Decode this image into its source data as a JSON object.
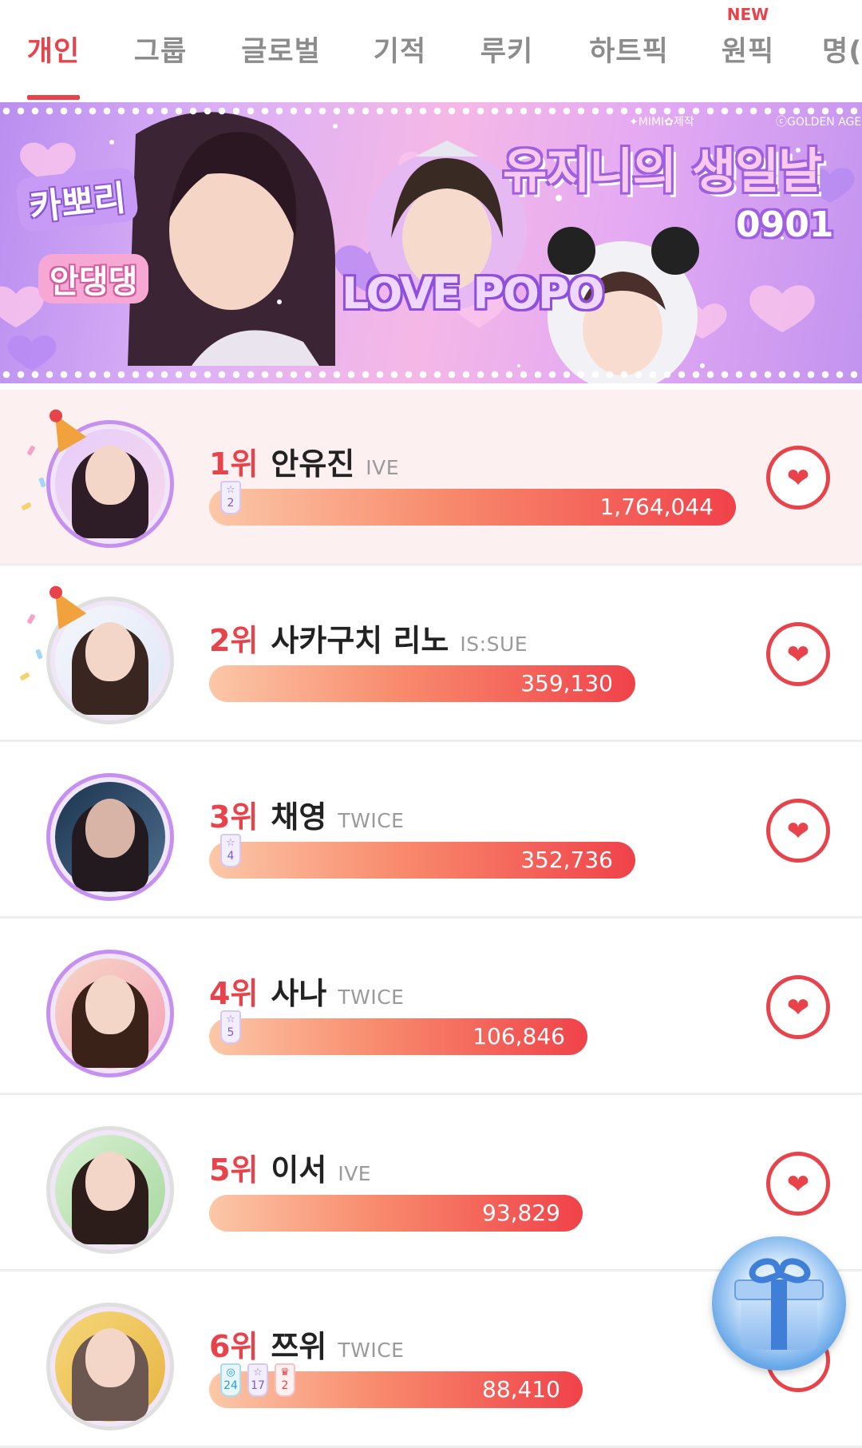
{
  "tabs": [
    {
      "label": "개인",
      "active": true
    },
    {
      "label": "그룹"
    },
    {
      "label": "글로벌"
    },
    {
      "label": "기적"
    },
    {
      "label": "루키"
    },
    {
      "label": "하트픽"
    },
    {
      "label": "원픽",
      "badge": "NEW"
    },
    {
      "label": "명("
    }
  ],
  "banner": {
    "tag1": "카뽀리",
    "tag2": "안댕댕",
    "title": "유지니의 생일날",
    "date": "0901",
    "love": "LOVE POPO",
    "credit_left": "✦MIMI✿제작",
    "credit_right": "ⓒGOLDEN AGE"
  },
  "ranking": [
    {
      "rank": "1위",
      "name": "안유진",
      "group": "IVE",
      "votes": "1,764,044",
      "badges": [
        {
          "icon": "star-icon",
          "value": "2"
        }
      ],
      "bar_fraction": 1.0,
      "birthday": true,
      "avatar_ring": "#c690f0"
    },
    {
      "rank": "2위",
      "name": "사카구치 리노",
      "group": "IS:SUE",
      "votes": "359,130",
      "badges": [],
      "bar_fraction": 0.81,
      "birthday": true,
      "avatar_ring": "#dfdfdf"
    },
    {
      "rank": "3위",
      "name": "채영",
      "group": "TWICE",
      "votes": "352,736",
      "badges": [
        {
          "icon": "star-icon",
          "value": "4"
        }
      ],
      "bar_fraction": 0.81,
      "birthday": false,
      "avatar_ring": "#c690f0"
    },
    {
      "rank": "4위",
      "name": "사나",
      "group": "TWICE",
      "votes": "106,846",
      "badges": [
        {
          "icon": "star-icon",
          "value": "5"
        }
      ],
      "bar_fraction": 0.72,
      "birthday": false,
      "avatar_ring": "#c690f0"
    },
    {
      "rank": "5위",
      "name": "이서",
      "group": "IVE",
      "votes": "93,829",
      "badges": [],
      "bar_fraction": 0.71,
      "birthday": false,
      "avatar_ring": "#dfdfdf"
    },
    {
      "rank": "6위",
      "name": "쯔위",
      "group": "TWICE",
      "votes": "88,410",
      "badges": [
        {
          "icon": "medal-icon",
          "value": "24"
        },
        {
          "icon": "star-icon",
          "value": "17"
        },
        {
          "icon": "crown-icon",
          "value": "2"
        }
      ],
      "bar_fraction": 0.71,
      "birthday": false,
      "avatar_ring": "#dfdfdf"
    }
  ],
  "vote_button": {
    "icon": "heart-icon",
    "glyph": "❤"
  },
  "gift_button": {
    "icon": "gift-icon"
  },
  "colors": {
    "accent": "#e8424a",
    "inactive_tab": "#8c8c8c",
    "highlight_row": "#fdf0f0"
  }
}
